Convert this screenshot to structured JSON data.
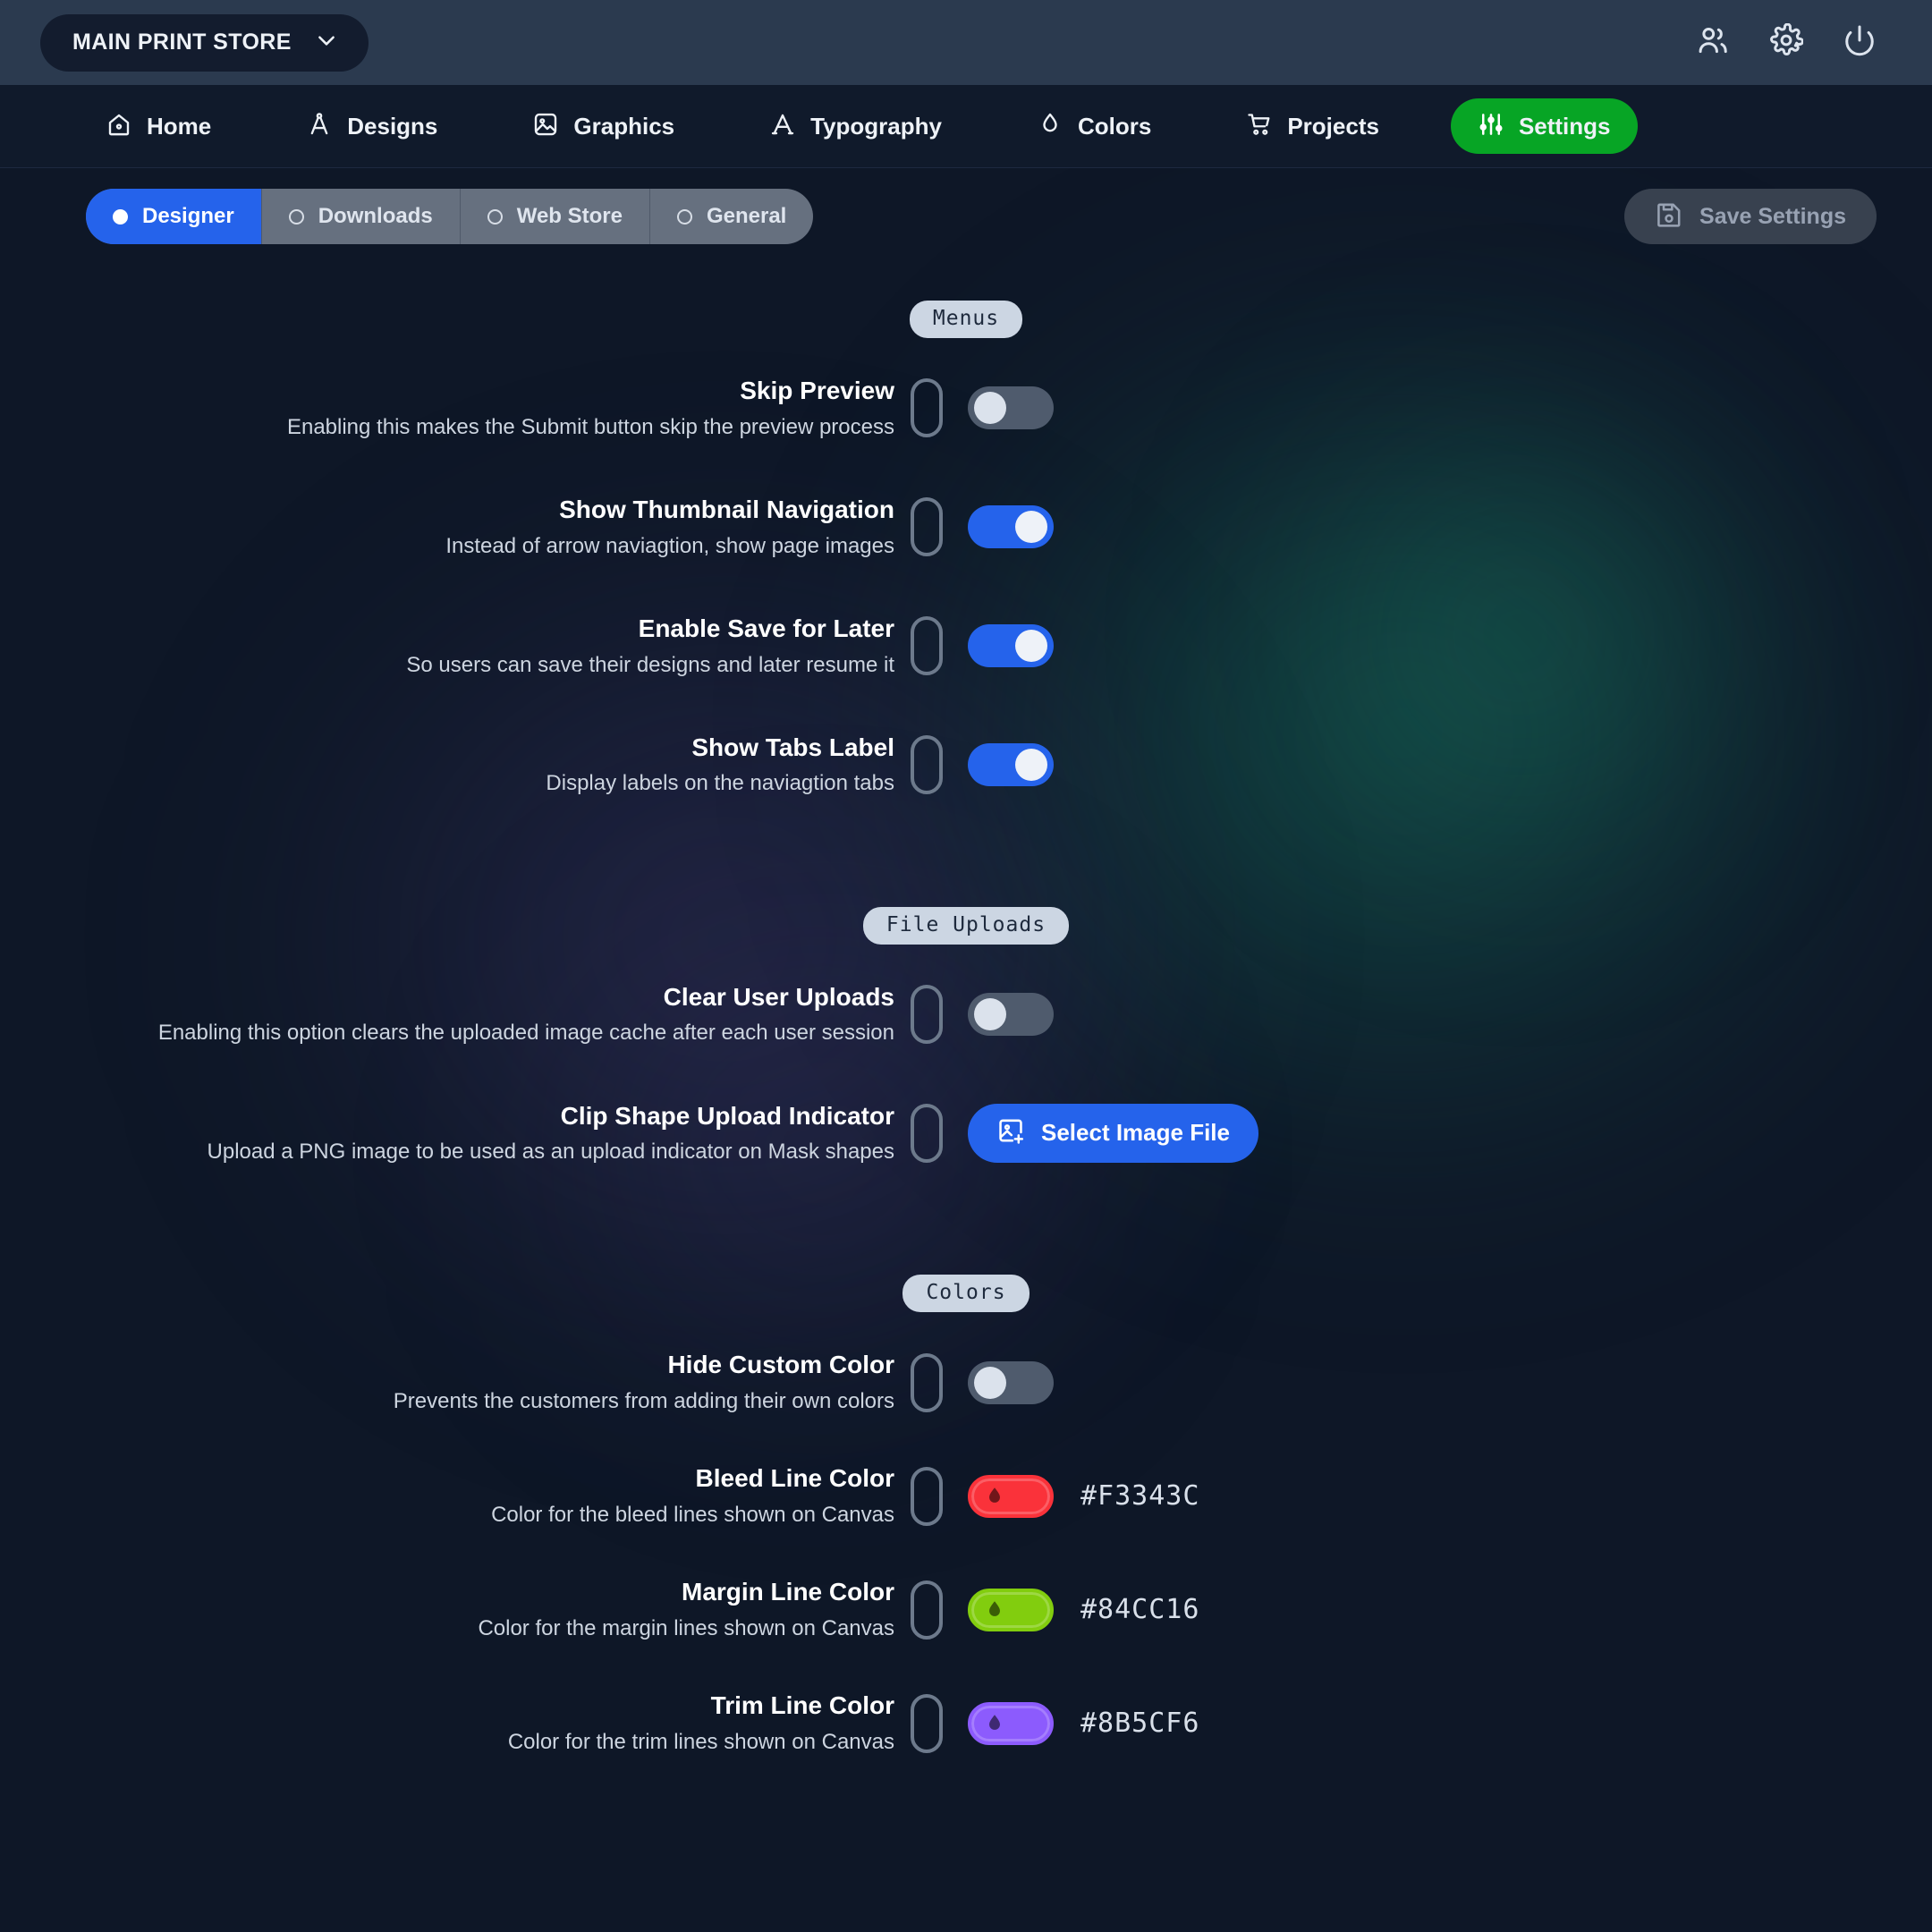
{
  "topbar": {
    "store_name": "MAIN PRINT STORE",
    "chevron_icon": "chevron-down-icon",
    "icons": [
      {
        "name": "users-icon",
        "glyph": "users"
      },
      {
        "name": "gear-icon",
        "glyph": "gear"
      },
      {
        "name": "power-icon",
        "glyph": "power"
      }
    ]
  },
  "nav": {
    "items": [
      {
        "label": "Home",
        "icon": "home-icon",
        "active": false
      },
      {
        "label": "Designs",
        "icon": "compass-icon",
        "active": false
      },
      {
        "label": "Graphics",
        "icon": "image-icon",
        "active": false
      },
      {
        "label": "Typography",
        "icon": "letter-a-icon",
        "active": false
      },
      {
        "label": "Colors",
        "icon": "droplet-icon",
        "active": false
      },
      {
        "label": "Projects",
        "icon": "cart-icon",
        "active": false
      },
      {
        "label": "Settings",
        "icon": "sliders-icon",
        "active": true
      }
    ],
    "active_color": "#07A525"
  },
  "tabs": {
    "items": [
      {
        "label": "Designer",
        "selected": true
      },
      {
        "label": "Downloads",
        "selected": false
      },
      {
        "label": "Web Store",
        "selected": false
      },
      {
        "label": "General",
        "selected": false
      }
    ],
    "active_color": "#2563EB",
    "group_bg": "#66707F"
  },
  "save_settings": {
    "label": "Save Settings",
    "icon": "save-disk-icon",
    "enabled": false
  },
  "sections": [
    {
      "badge": "Menus",
      "rows": [
        {
          "title": "Skip Preview",
          "desc": "Enabling this makes the Submit button skip the preview process",
          "control": "toggle",
          "value": "off"
        },
        {
          "title": "Show Thumbnail Navigation",
          "desc": "Instead of arrow naviagtion, show page images",
          "control": "toggle",
          "value": "on"
        },
        {
          "title": "Enable Save for Later",
          "desc": "So users can save their designs and later resume it",
          "control": "toggle",
          "value": "on"
        },
        {
          "title": "Show Tabs Label",
          "desc": "Display labels on the naviagtion tabs",
          "control": "toggle",
          "value": "on"
        }
      ]
    },
    {
      "badge": "File Uploads",
      "rows": [
        {
          "title": "Clear User Uploads",
          "desc": "Enabling this option clears the uploaded image cache after each user session",
          "control": "toggle",
          "value": "off"
        },
        {
          "title": "Clip Shape Upload Indicator",
          "desc": "Upload a PNG image to be used as an upload indicator on Mask shapes",
          "control": "button",
          "button_label": "Select Image File",
          "button_icon": "image-plus-icon"
        }
      ]
    },
    {
      "badge": "Colors",
      "rows": [
        {
          "title": "Hide Custom Color",
          "desc": "Prevents the customers from adding their own colors",
          "control": "toggle",
          "value": "off"
        },
        {
          "title": "Bleed Line Color",
          "desc": "Color for the bleed lines shown on Canvas",
          "control": "color",
          "value": "#F3343C"
        },
        {
          "title": "Margin Line Color",
          "desc": "Color for the margin lines shown on Canvas",
          "control": "color",
          "value": "#84CC16"
        },
        {
          "title": "Trim Line Color",
          "desc": "Color for the trim lines shown on Canvas",
          "control": "color",
          "value": "#8B5CF6"
        }
      ]
    }
  ]
}
